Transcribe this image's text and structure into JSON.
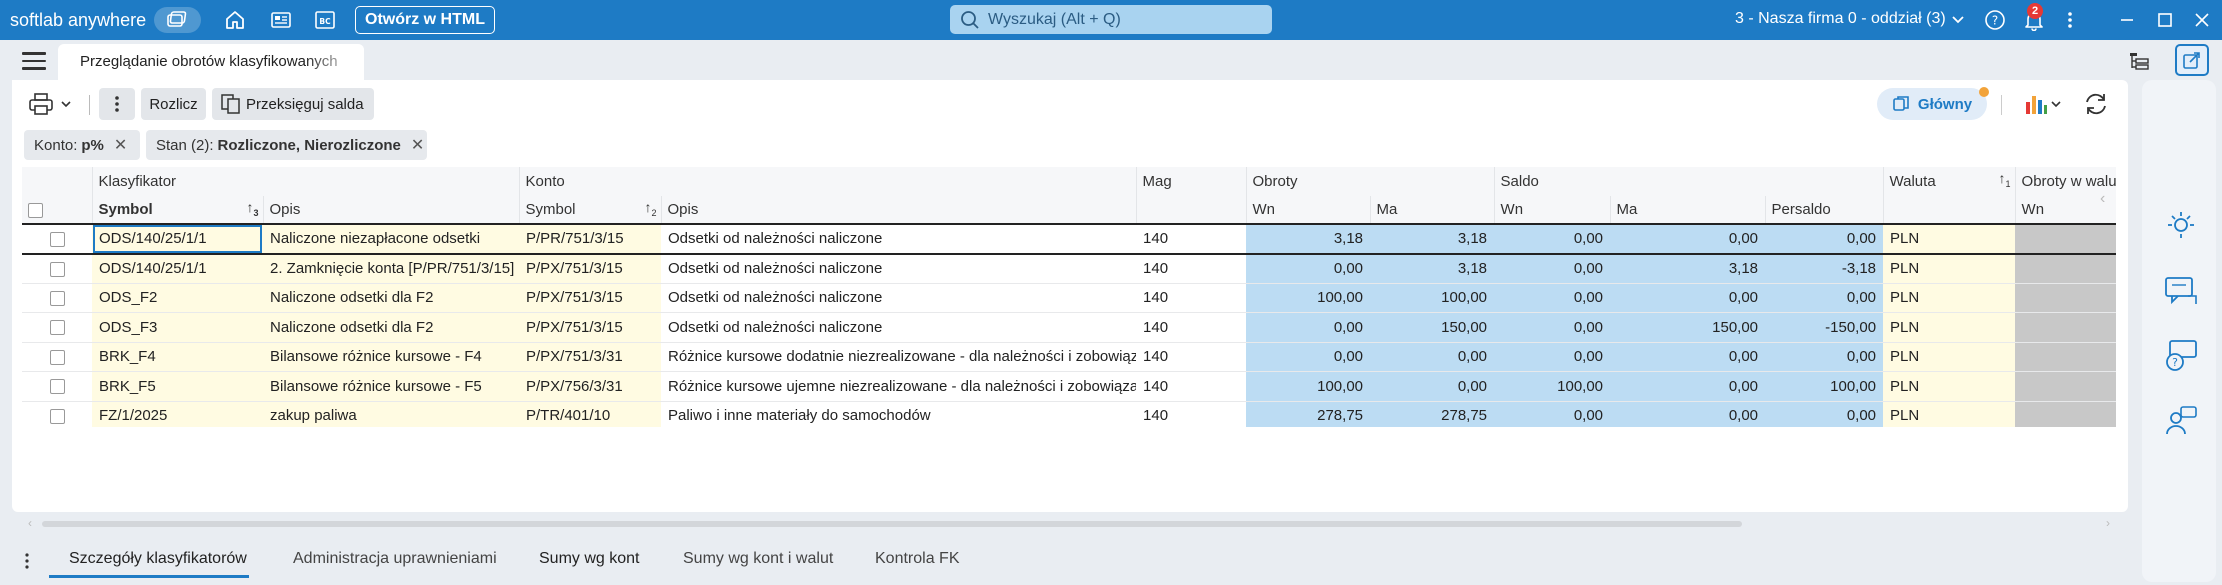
{
  "app": {
    "brand": "softlab anywhere",
    "open_html_label": "Otwórz w HTML",
    "search_placeholder": "Wyszukaj (Alt + Q)",
    "company": "3 - Nasza firma 0 - oddział (3)",
    "notification_count": "2"
  },
  "doc_tab": {
    "label": "Przeglądanie obrotów klasyfikowanych"
  },
  "toolbar": {
    "rozlicz": "Rozlicz",
    "przeksieguj": "Przeksięguj salda",
    "glowny": "Główny"
  },
  "filters": [
    {
      "label": "Konto:",
      "value": "p%"
    },
    {
      "label": "Stan (2):",
      "value": "Rozliczone, Nierozliczone"
    }
  ],
  "grid": {
    "group_headers": {
      "klasyfikator": "Klasyfikator",
      "konto": "Konto",
      "mag": "Mag",
      "obroty": "Obroty",
      "saldo": "Saldo",
      "waluta": "Waluta",
      "obroty_waluta": "Obroty w walucie"
    },
    "columns": {
      "symbol": "Symbol",
      "opis": "Opis",
      "konto_symbol": "Symbol",
      "konto_opis": "Opis",
      "wn": "Wn",
      "ma": "Ma",
      "saldo_wn": "Wn",
      "saldo_ma": "Ma",
      "persaldo": "Persaldo",
      "wal_wn": "Wn"
    },
    "sort": {
      "symbol": "3",
      "konto_symbol": "2",
      "waluta": "1"
    },
    "rows": [
      {
        "symbol": "ODS/140/25/1/1",
        "opis": "Naliczone niezapłacone odsetki",
        "konto": "P/PR/751/3/15",
        "konto_opis": "Odsetki od należności naliczone",
        "mag": "140",
        "wn": "3,18",
        "ma": "3,18",
        "saldo_wn": "0,00",
        "saldo_ma": "0,00",
        "persaldo": "0,00",
        "waluta": "PLN"
      },
      {
        "symbol": "ODS/140/25/1/1",
        "opis": "2. Zamknięcie konta [P/PR/751/3/15]",
        "konto": "P/PX/751/3/15",
        "konto_opis": "Odsetki od należności naliczone",
        "mag": "140",
        "wn": "0,00",
        "ma": "3,18",
        "saldo_wn": "0,00",
        "saldo_ma": "3,18",
        "persaldo": "-3,18",
        "waluta": "PLN"
      },
      {
        "symbol": "ODS_F2",
        "opis": "Naliczone odsetki dla F2",
        "konto": "P/PX/751/3/15",
        "konto_opis": "Odsetki od należności naliczone",
        "mag": "140",
        "wn": "100,00",
        "ma": "100,00",
        "saldo_wn": "0,00",
        "saldo_ma": "0,00",
        "persaldo": "0,00",
        "waluta": "PLN"
      },
      {
        "symbol": "ODS_F3",
        "opis": "Naliczone odsetki dla F2",
        "konto": "P/PX/751/3/15",
        "konto_opis": "Odsetki od należności naliczone",
        "mag": "140",
        "wn": "0,00",
        "ma": "150,00",
        "saldo_wn": "0,00",
        "saldo_ma": "150,00",
        "persaldo": "-150,00",
        "waluta": "PLN"
      },
      {
        "symbol": "BRK_F4",
        "opis": "Bilansowe różnice kursowe - F4",
        "konto": "P/PX/751/3/31",
        "konto_opis": "Różnice kursowe dodatnie niezrealizowane -  dla należności i zobowiązań",
        "mag": "140",
        "wn": "0,00",
        "ma": "0,00",
        "saldo_wn": "0,00",
        "saldo_ma": "0,00",
        "persaldo": "0,00",
        "waluta": "PLN"
      },
      {
        "symbol": "BRK_F5",
        "opis": "Bilansowe różnice kursowe - F5",
        "konto": "P/PX/756/3/31",
        "konto_opis": "Różnice kursowe ujemne niezrealizowane -  dla należności i zobowiązań",
        "mag": "140",
        "wn": "100,00",
        "ma": "0,00",
        "saldo_wn": "100,00",
        "saldo_ma": "0,00",
        "persaldo": "100,00",
        "waluta": "PLN"
      },
      {
        "symbol": "FZ/1/2025",
        "opis": "zakup paliwa",
        "konto": "P/TR/401/10",
        "konto_opis": "Paliwo i inne materiały do samochodów",
        "mag": "140",
        "wn": "278,75",
        "ma": "278,75",
        "saldo_wn": "0,00",
        "saldo_ma": "0,00",
        "persaldo": "0,00",
        "waluta": "PLN"
      }
    ]
  },
  "bottom_tabs": [
    "Szczegóły klasyfikatorów",
    "Administracja uprawnieniami",
    "Sumy wg kont",
    "Sumy wg kont i walut",
    "Kontrola FK"
  ],
  "colors": {
    "accent": "#1e7bc5",
    "numeric_cell": "#bcdcf3",
    "text_cell": "#fffbe2",
    "badge": "#e53935"
  }
}
